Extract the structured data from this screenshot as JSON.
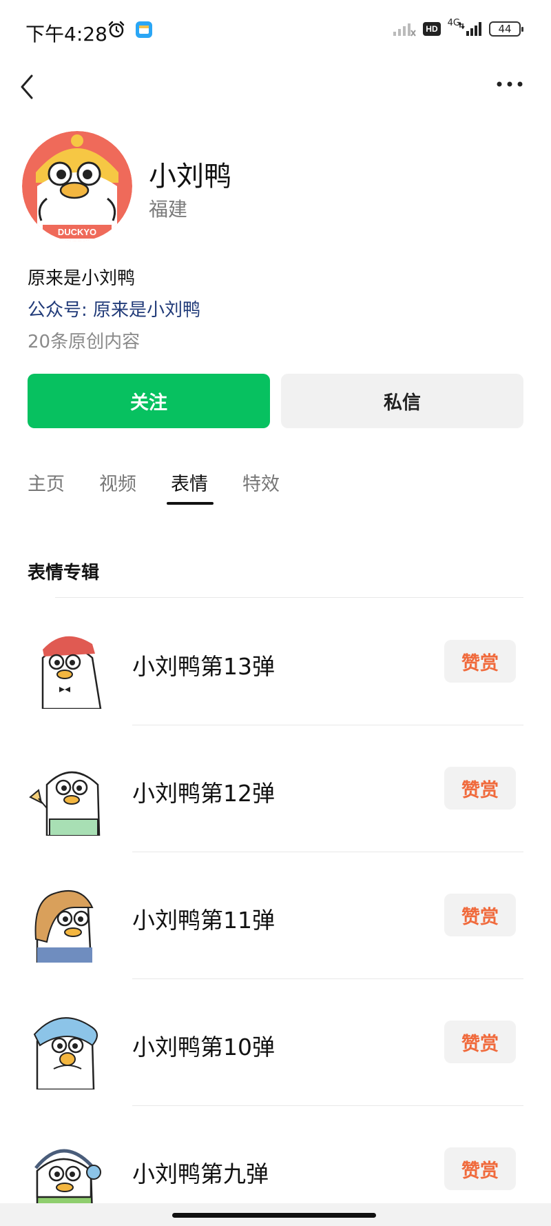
{
  "status_bar": {
    "time": "下午4:28",
    "network_label": "4G",
    "hd_label": "HD",
    "battery": "44"
  },
  "nav": {
    "back_icon": "chevron-left-icon",
    "more_icon": "more-dots-icon"
  },
  "profile": {
    "name": "小刘鸭",
    "region": "福建",
    "bio": "原来是小刘鸭",
    "official_account": "公众号: 原来是小刘鸭",
    "original_count": "20条原创内容",
    "avatar_text": "DUCKYO"
  },
  "actions": {
    "follow_label": "关注",
    "message_label": "私信"
  },
  "tabs": [
    {
      "label": "主页",
      "active": false
    },
    {
      "label": "视频",
      "active": false
    },
    {
      "label": "表情",
      "active": true
    },
    {
      "label": "特效",
      "active": false
    }
  ],
  "section": {
    "title": "表情专辑"
  },
  "stickers": [
    {
      "title": "小刘鸭第13弹",
      "reward_label": "赞赏",
      "accent": "#e05a52"
    },
    {
      "title": "小刘鸭第12弹",
      "reward_label": "赞赏",
      "accent": "#a8dfb4"
    },
    {
      "title": "小刘鸭第11弹",
      "reward_label": "赞赏",
      "accent": "#d9a05b"
    },
    {
      "title": "小刘鸭第10弹",
      "reward_label": "赞赏",
      "accent": "#8cc4e8"
    },
    {
      "title": "小刘鸭第九弹",
      "reward_label": "赞赏",
      "accent": "#8fce6e"
    }
  ],
  "colors": {
    "follow": "#07c160",
    "reward_text": "#f06a3c",
    "official_link": "#203a78"
  }
}
